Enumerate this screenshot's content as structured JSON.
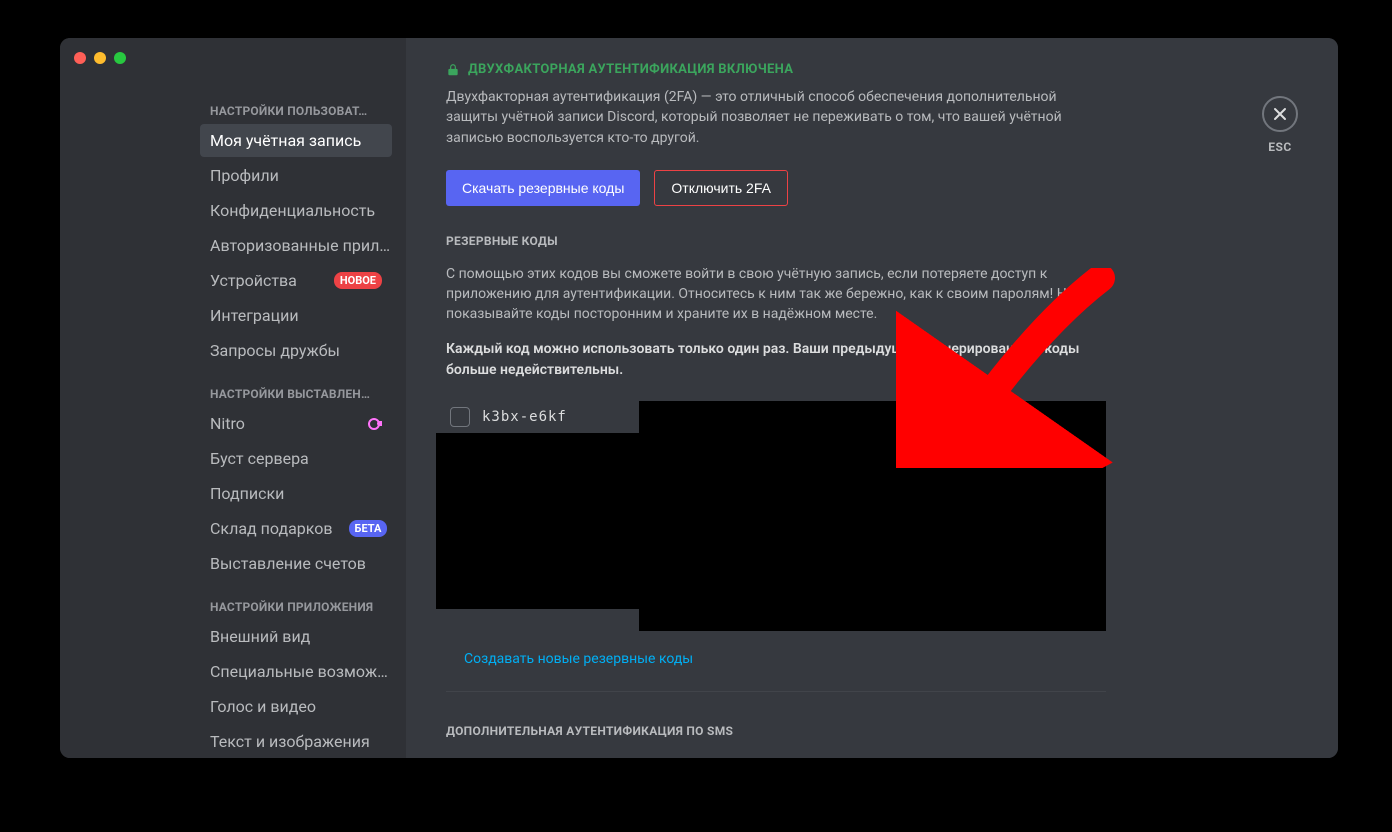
{
  "sidebar": {
    "sections": [
      {
        "header": "НАСТРОЙКИ ПОЛЬЗОВАТ…",
        "items": [
          {
            "label": "Моя учётная запись",
            "active": true
          },
          {
            "label": "Профили"
          },
          {
            "label": "Конфиденциальность"
          },
          {
            "label": "Авторизованные прил…"
          },
          {
            "label": "Устройства",
            "badge": "НОВОЕ",
            "badgeColor": "red"
          },
          {
            "label": "Интеграции"
          },
          {
            "label": "Запросы дружбы"
          }
        ]
      },
      {
        "header": "НАСТРОЙКИ ВЫСТАВЛЕН…",
        "items": [
          {
            "label": "Nitro",
            "nitro": true
          },
          {
            "label": "Буст сервера"
          },
          {
            "label": "Подписки"
          },
          {
            "label": "Склад подарков",
            "badge": "БЕТА",
            "badgeColor": "blurple"
          },
          {
            "label": "Выставление счетов"
          }
        ]
      },
      {
        "header": "НАСТРОЙКИ ПРИЛОЖЕНИЯ",
        "items": [
          {
            "label": "Внешний вид"
          },
          {
            "label": "Специальные возмож…"
          },
          {
            "label": "Голос и видео"
          },
          {
            "label": "Текст и изображения"
          }
        ]
      }
    ]
  },
  "close": {
    "label": "ESC"
  },
  "content": {
    "twofa_title": "ДВУХФАКТОРНАЯ АУТЕНТИФИКАЦИЯ ВКЛЮЧЕНА",
    "twofa_desc": "Двухфакторная аутентификация (2FA) — это отличный способ обеспечения дополнительной защиты учётной записи Discord, который позволяет не переживать о том, что вашей учётной записью воспользуется кто-то другой.",
    "btn_download": "Скачать резервные коды",
    "btn_disable": "Отключить 2FA",
    "backup_title": "РЕЗЕРВНЫЕ КОДЫ",
    "backup_desc": "С помощью этих кодов вы сможете войти в свою учётную запись, если потеряете доступ к приложению для аутентификации. Относитесь к ним так же бережно, как к своим паролям! Не показывайте коды посторонним и храните их в надёжном месте.",
    "backup_bold": "Каждый код можно использовать только один раз. Ваши предыдущие сгенерированные коды больше недействительны.",
    "code1": "k3bx-e6kf",
    "generate_link": "Создавать новые резервные коды",
    "sms_title": "ДОПОЛНИТЕЛЬНАЯ АУТЕНТИФИКАЦИЯ ПО SMS"
  }
}
